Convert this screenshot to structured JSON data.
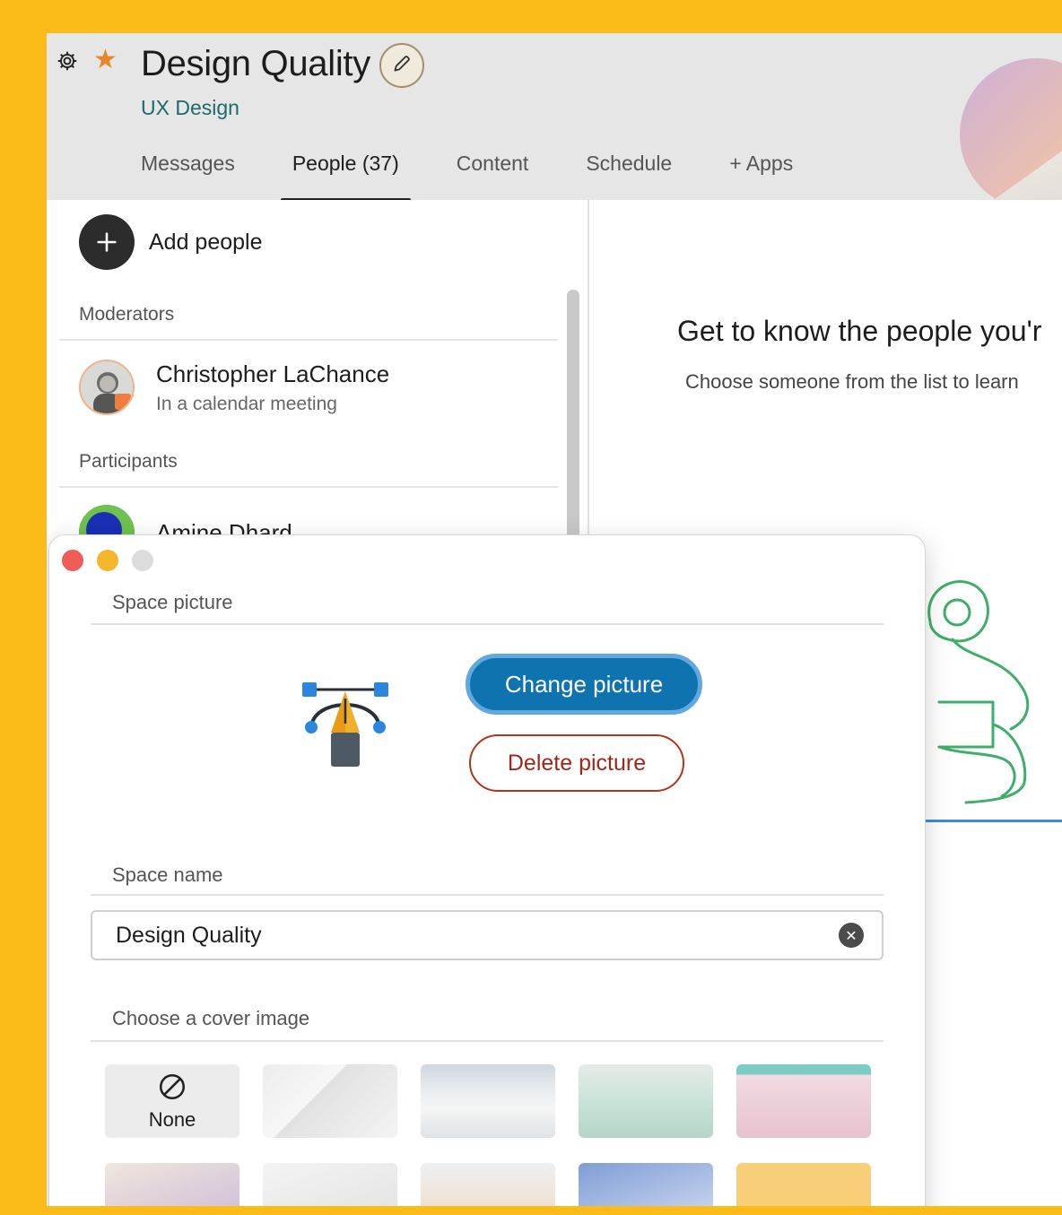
{
  "header": {
    "title": "Design Quality",
    "subtitle": "UX Design",
    "tabs": [
      {
        "label": "Messages"
      },
      {
        "label": "People (37)",
        "active": true
      },
      {
        "label": "Content"
      },
      {
        "label": "Schedule"
      },
      {
        "label": "+ Apps"
      }
    ],
    "icons": {
      "settings": "gear-icon",
      "favorite": "star-icon",
      "edit": "pencil-icon"
    },
    "star_color": "#E8862A"
  },
  "people_panel": {
    "add_label": "Add people",
    "moderators_label": "Moderators",
    "moderators": [
      {
        "name": "Christopher LaChance",
        "status": "In a calendar meeting"
      }
    ],
    "participants_label": "Participants",
    "participants": [
      {
        "name": "Amine Dhard"
      }
    ]
  },
  "detail_panel": {
    "title": "Get to know the people you'r",
    "subtitle": "Choose someone from the list to learn"
  },
  "dialog": {
    "space_picture_label": "Space picture",
    "change_button": "Change picture",
    "delete_button": "Delete picture",
    "space_name_label": "Space name",
    "space_name_value": "Design Quality",
    "cover_label": "Choose a cover image",
    "none_label": "None",
    "accent_color": "#0E73AF",
    "danger_color": "#A3261A"
  },
  "frame_color": "#FDBB1A"
}
